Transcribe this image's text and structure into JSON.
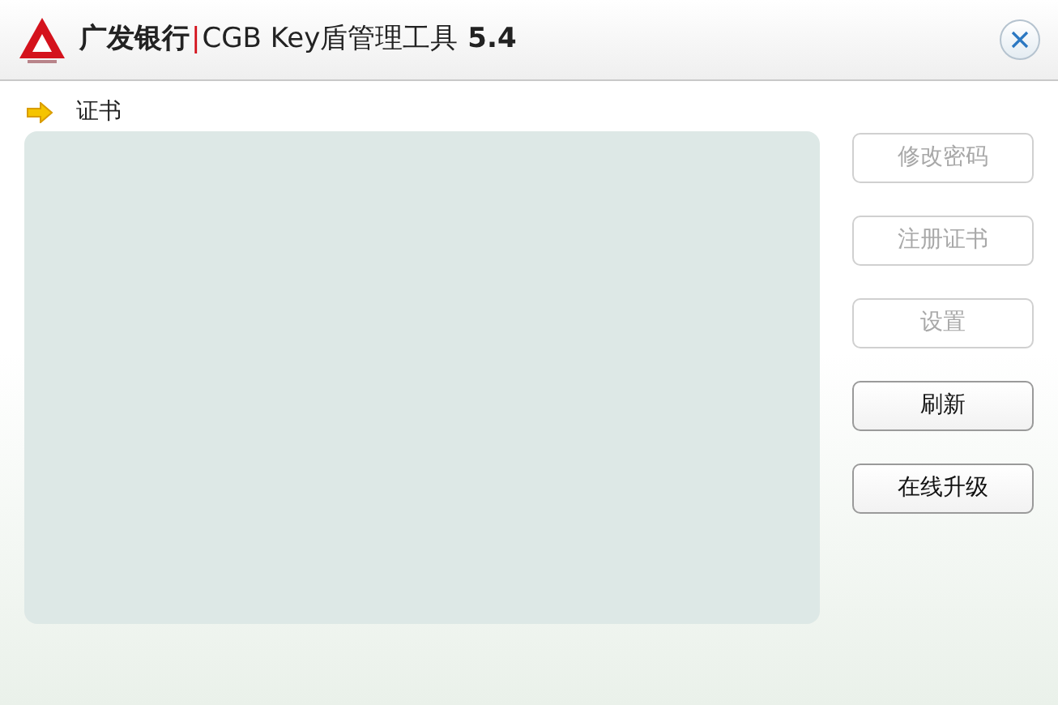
{
  "window": {
    "title": {
      "brand": "广发银行",
      "separator": "|",
      "product": "CGB Key盾管理工具",
      "version": "5.4"
    }
  },
  "section": {
    "label": "证书"
  },
  "buttons": [
    {
      "label": "修改密码",
      "disabled": true
    },
    {
      "label": "注册证书",
      "disabled": true
    },
    {
      "label": "设置",
      "disabled": true
    },
    {
      "label": "刷新",
      "disabled": false
    },
    {
      "label": "在线升级",
      "disabled": false
    }
  ]
}
